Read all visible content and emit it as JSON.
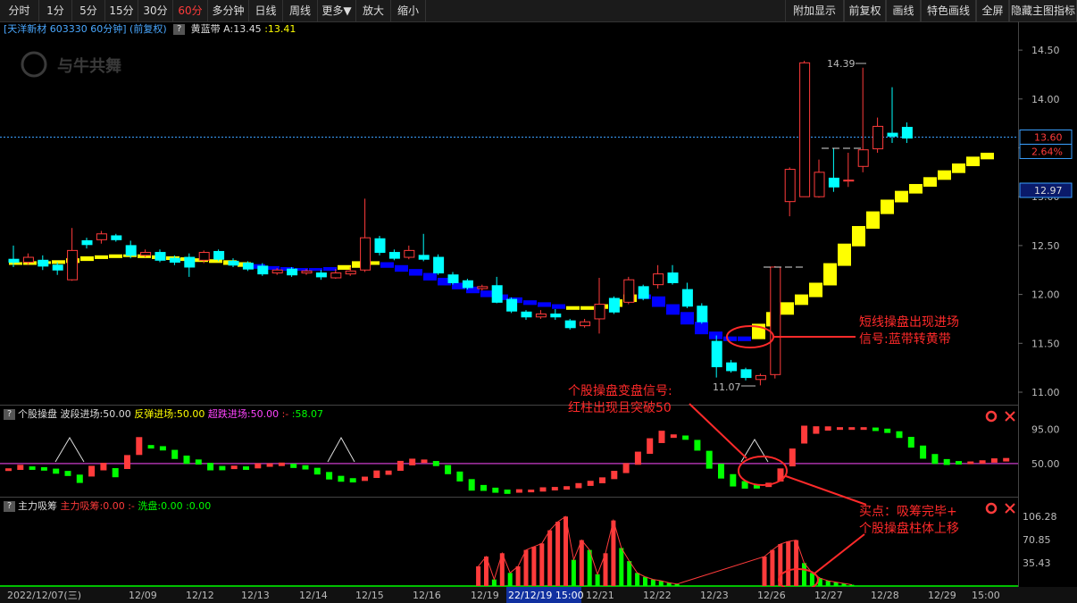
{
  "toolbar": {
    "left_buttons": [
      "分时",
      "1分",
      "5分",
      "15分",
      "30分",
      "60分",
      "多分钟",
      "日线",
      "周线",
      "更多▼",
      "放大",
      "缩小"
    ],
    "active_index": 5,
    "right_buttons": [
      "附加显示",
      "前复权",
      "画线",
      "特色画线",
      "全屏",
      "隐藏主图指标"
    ]
  },
  "header": {
    "stock": "[天洋新材 603330 60分钟] (前复权)",
    "indicator_name": "黄蓝带",
    "value_a": "A:13.45",
    "value_b": ":13.41"
  },
  "watermark": "与牛共舞",
  "price_axis": {
    "ticks": [
      "14.50",
      "14.00",
      "13.50",
      "13.00",
      "12.50",
      "12.00",
      "11.50",
      "11.00"
    ],
    "current_price": "13.60",
    "change_pct": "2.64%",
    "cursor_price": "12.97"
  },
  "peak_label": "14.39",
  "low_label": "11.07",
  "indicator1": {
    "name": "个股操盘",
    "items": [
      {
        "text": "波段进场:50.00",
        "color": "#dddddd"
      },
      {
        "text": "反弹进场:50.00",
        "color": "#ffff00"
      },
      {
        "text": "超跌进场:50.00",
        "color": "#ff44ff"
      },
      {
        "text": ":-",
        "color": "#ff3b3b"
      },
      {
        "text": ":58.07",
        "color": "#00ff00"
      }
    ],
    "ticks": [
      "95.00",
      "50.00"
    ]
  },
  "indicator2": {
    "name": "主力吸筹",
    "items": [
      {
        "text": "主力吸筹:0.00",
        "color": "#ff3b3b"
      },
      {
        "text": ":-",
        "color": "#ff3b3b"
      },
      {
        "text": "洗盘:0.00",
        "color": "#00ff00"
      },
      {
        "text": ":0.00",
        "color": "#00ff00"
      }
    ],
    "ticks": [
      "106.28",
      "70.85",
      "35.43"
    ]
  },
  "time_axis": {
    "labels": [
      "2022/12/07(三)",
      "12/09",
      "12/12",
      "12/13",
      "12/14",
      "12/15",
      "12/16",
      "12/19",
      "22/12/19 15:00",
      "12/21",
      "12/22",
      "12/23",
      "12/26",
      "12/27",
      "12/28",
      "12/29",
      "15:00"
    ]
  },
  "annotations": {
    "main_signal": [
      "短线操盘出现进场",
      "信号:蓝带转黄带"
    ],
    "ind1_signal": [
      "个股操盘变盘信号:",
      "红柱出现且突破50"
    ],
    "buy_point": [
      "买点：吸筹完毕+",
      "个股操盘柱体上移"
    ]
  },
  "colors": {
    "up": "#ff3b3b",
    "down": "#00ffff",
    "yellow": "#ffff00",
    "blue": "#0000ff",
    "green": "#00ff00",
    "magenta": "#ff44ff"
  },
  "chart_data": {
    "type": "candlestick",
    "price_range": [
      11.0,
      14.5
    ],
    "candles": [
      {
        "o": 12.36,
        "c": 12.33,
        "h": 12.5,
        "l": 12.28
      },
      {
        "o": 12.33,
        "c": 12.38,
        "h": 12.42,
        "l": 12.3
      },
      {
        "o": 12.35,
        "c": 12.29,
        "h": 12.4,
        "l": 12.25
      },
      {
        "o": 12.3,
        "c": 12.25,
        "h": 12.33,
        "l": 12.2
      },
      {
        "o": 12.15,
        "c": 12.45,
        "h": 12.68,
        "l": 12.14
      },
      {
        "o": 12.55,
        "c": 12.51,
        "h": 12.58,
        "l": 12.47
      },
      {
        "o": 12.56,
        "c": 12.62,
        "h": 12.65,
        "l": 12.52
      },
      {
        "o": 12.6,
        "c": 12.56,
        "h": 12.62,
        "l": 12.54
      },
      {
        "o": 12.5,
        "c": 12.4,
        "h": 12.55,
        "l": 12.37
      },
      {
        "o": 12.4,
        "c": 12.43,
        "h": 12.46,
        "l": 12.38
      },
      {
        "o": 12.43,
        "c": 12.35,
        "h": 12.46,
        "l": 12.33
      },
      {
        "o": 12.37,
        "c": 12.33,
        "h": 12.4,
        "l": 12.3
      },
      {
        "o": 12.38,
        "c": 12.28,
        "h": 12.42,
        "l": 12.18
      },
      {
        "o": 12.35,
        "c": 12.43,
        "h": 12.45,
        "l": 12.32
      },
      {
        "o": 12.44,
        "c": 12.36,
        "h": 12.46,
        "l": 12.34
      },
      {
        "o": 12.34,
        "c": 12.3,
        "h": 12.37,
        "l": 12.28
      },
      {
        "o": 12.32,
        "c": 12.26,
        "h": 12.34,
        "l": 12.24
      },
      {
        "o": 12.29,
        "c": 12.21,
        "h": 12.32,
        "l": 12.19
      },
      {
        "o": 12.22,
        "c": 12.25,
        "h": 12.27,
        "l": 12.2
      },
      {
        "o": 12.26,
        "c": 12.2,
        "h": 12.28,
        "l": 12.18
      },
      {
        "o": 12.22,
        "c": 12.24,
        "h": 12.26,
        "l": 12.2
      },
      {
        "o": 12.22,
        "c": 12.18,
        "h": 12.25,
        "l": 12.15
      },
      {
        "o": 12.17,
        "c": 12.22,
        "h": 12.26,
        "l": 12.16
      },
      {
        "o": 12.21,
        "c": 12.24,
        "h": 12.28,
        "l": 12.19
      },
      {
        "o": 12.25,
        "c": 12.58,
        "h": 12.98,
        "l": 12.23
      },
      {
        "o": 12.57,
        "c": 12.43,
        "h": 12.6,
        "l": 12.4
      },
      {
        "o": 12.43,
        "c": 12.37,
        "h": 12.46,
        "l": 12.35
      },
      {
        "o": 12.38,
        "c": 12.45,
        "h": 12.5,
        "l": 12.36
      },
      {
        "o": 12.4,
        "c": 12.36,
        "h": 12.62,
        "l": 12.34
      },
      {
        "o": 12.38,
        "c": 12.22,
        "h": 12.41,
        "l": 12.2
      },
      {
        "o": 12.2,
        "c": 12.12,
        "h": 12.23,
        "l": 12.1
      },
      {
        "o": 12.14,
        "c": 12.07,
        "h": 12.16,
        "l": 12.05
      },
      {
        "o": 12.06,
        "c": 12.08,
        "h": 12.1,
        "l": 12.04
      },
      {
        "o": 12.09,
        "c": 11.92,
        "h": 12.18,
        "l": 11.91
      },
      {
        "o": 11.95,
        "c": 11.83,
        "h": 11.97,
        "l": 11.81
      },
      {
        "o": 11.82,
        "c": 11.77,
        "h": 11.84,
        "l": 11.74
      },
      {
        "o": 11.77,
        "c": 11.8,
        "h": 11.84,
        "l": 11.75
      },
      {
        "o": 11.8,
        "c": 11.77,
        "h": 11.85,
        "l": 11.74
      },
      {
        "o": 11.73,
        "c": 11.66,
        "h": 11.75,
        "l": 11.64
      },
      {
        "o": 11.68,
        "c": 11.72,
        "h": 11.75,
        "l": 11.66
      },
      {
        "o": 11.75,
        "c": 11.9,
        "h": 12.17,
        "l": 11.6
      },
      {
        "o": 11.96,
        "c": 11.82,
        "h": 11.98,
        "l": 11.8
      },
      {
        "o": 11.92,
        "c": 12.15,
        "h": 12.18,
        "l": 11.9
      },
      {
        "o": 12.08,
        "c": 11.96,
        "h": 12.1,
        "l": 11.94
      },
      {
        "o": 12.1,
        "c": 12.21,
        "h": 12.3,
        "l": 12.06
      },
      {
        "o": 12.22,
        "c": 12.12,
        "h": 12.3,
        "l": 12.1
      },
      {
        "o": 12.05,
        "c": 11.88,
        "h": 12.12,
        "l": 11.86
      },
      {
        "o": 11.88,
        "c": 11.72,
        "h": 11.91,
        "l": 11.7
      },
      {
        "o": 11.52,
        "c": 11.26,
        "h": 11.58,
        "l": 11.15
      },
      {
        "o": 11.3,
        "c": 11.22,
        "h": 11.33,
        "l": 11.2
      },
      {
        "o": 11.23,
        "c": 11.15,
        "h": 11.25,
        "l": 11.12
      },
      {
        "o": 11.13,
        "c": 11.17,
        "h": 11.19,
        "l": 11.07
      },
      {
        "o": 11.18,
        "c": 12.28,
        "h": 12.29,
        "l": 11.14
      },
      {
        "o": 12.95,
        "c": 13.28,
        "h": 13.3,
        "l": 12.8
      },
      {
        "o": 13.0,
        "c": 14.37,
        "h": 14.39,
        "l": 13.01
      },
      {
        "o": 13.0,
        "c": 13.25,
        "h": 13.38,
        "l": 12.99
      },
      {
        "o": 13.19,
        "c": 13.1,
        "h": 13.5,
        "l": 13.05
      },
      {
        "o": 13.16,
        "c": 13.17,
        "h": 13.45,
        "l": 13.1
      },
      {
        "o": 13.31,
        "c": 13.48,
        "h": 14.32,
        "l": 13.25
      },
      {
        "o": 13.49,
        "c": 13.72,
        "h": 13.81,
        "l": 13.45
      },
      {
        "o": 13.65,
        "c": 13.62,
        "h": 14.12,
        "l": 13.55
      },
      {
        "o": 13.71,
        "c": 13.6,
        "h": 13.76,
        "l": 13.55
      }
    ],
    "band": [
      12.33,
      12.33,
      12.34,
      12.34,
      12.35,
      12.37,
      12.39,
      12.4,
      12.41,
      12.41,
      12.4,
      12.39,
      12.38,
      12.37,
      12.36,
      12.35,
      12.33,
      12.31,
      12.29,
      12.28,
      12.27,
      12.27,
      12.27,
      12.28,
      12.3,
      12.34,
      12.33,
      12.3,
      12.26,
      12.22,
      12.17,
      12.12,
      12.08,
      12.04,
      12.0,
      11.97,
      11.94,
      11.92,
      11.9,
      11.88,
      11.87,
      11.88,
      11.9,
      11.95,
      12.0,
      11.98,
      11.9,
      11.82,
      11.72,
      11.62,
      11.57,
      11.55,
      11.57,
      11.7,
      11.82,
      11.92,
      12.0,
      12.12,
      12.32,
      12.52,
      12.7,
      12.85,
      12.97,
      13.06,
      13.13,
      13.2,
      13.27,
      13.34,
      13.41,
      13.45
    ],
    "band_colors": [
      "Y",
      "Y",
      "Y",
      "Y",
      "Y",
      "Y",
      "Y",
      "Y",
      "Y",
      "Y",
      "Y",
      "Y",
      "Y",
      "Y",
      "Y",
      "Y",
      "Y",
      "Y",
      "B",
      "B",
      "B",
      "B",
      "B",
      "B",
      "Y",
      "Y",
      "Y",
      "B",
      "B",
      "B",
      "B",
      "B",
      "B",
      "B",
      "B",
      "B",
      "B",
      "B",
      "B",
      "B",
      "Y",
      "Y",
      "Y",
      "Y",
      "Y",
      "B",
      "B",
      "B",
      "B",
      "B",
      "B",
      "B",
      "B",
      "Y",
      "Y",
      "Y",
      "Y",
      "Y",
      "Y",
      "Y",
      "Y",
      "Y",
      "Y",
      "Y",
      "Y",
      "Y",
      "Y",
      "Y",
      "Y",
      "Y"
    ],
    "indicator1_bars": [
      42,
      45,
      44,
      43,
      40,
      37,
      30,
      40,
      46,
      38,
      52,
      73,
      72,
      70,
      62,
      55,
      52,
      46,
      44,
      45,
      44,
      47,
      48,
      49,
      47,
      45,
      40,
      34,
      30,
      28,
      30,
      36,
      38,
      47,
      52,
      53,
      50,
      42,
      33,
      22,
      18,
      15,
      13,
      14,
      14,
      16,
      17,
      18,
      21,
      24,
      28,
      35,
      44,
      57,
      73,
      85,
      86,
      84,
      74,
      55,
      40,
      28,
      22,
      20,
      22,
      35,
      58,
      88,
      94,
      96,
      96,
      96,
      96,
      95,
      93,
      88,
      78,
      65,
      56,
      52,
      51,
      51,
      52,
      54,
      55
    ],
    "indicator2_bars": [
      0,
      0,
      0,
      0,
      0,
      0,
      0,
      0,
      0,
      0,
      0,
      0,
      0,
      0,
      0,
      0,
      0,
      0,
      0,
      0,
      0,
      0,
      0,
      0,
      0,
      0,
      0,
      0,
      0,
      0,
      0,
      0,
      0,
      0,
      0,
      0,
      0,
      0,
      0,
      0,
      0,
      0,
      0,
      0,
      0,
      0,
      0,
      0,
      0,
      0,
      0,
      0,
      0,
      0,
      0,
      0,
      0,
      0,
      0,
      30,
      45,
      10,
      50,
      20,
      30,
      55,
      60,
      65,
      85,
      98,
      106,
      40,
      70,
      55,
      18,
      50,
      100,
      58,
      38,
      20,
      14,
      10,
      8,
      5,
      3,
      0,
      0,
      0,
      0,
      0,
      0,
      0,
      0,
      0,
      0,
      45,
      55,
      64,
      68,
      70,
      35,
      20,
      12,
      8,
      6,
      4,
      2
    ]
  }
}
